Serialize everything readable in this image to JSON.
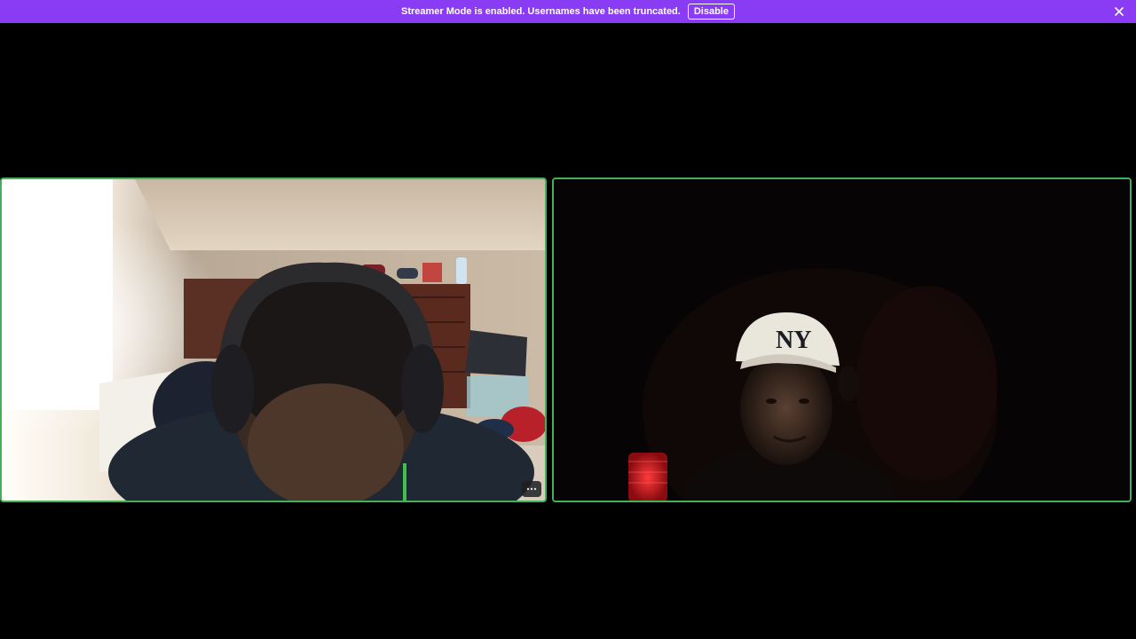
{
  "notice_bar": {
    "message": "Streamer Mode is enabled. Usernames have been truncated.",
    "disable_label": "Disable",
    "close_icon": "close-icon",
    "background": "#8a3cf5"
  },
  "call": {
    "active_speaker_border": "#43b05c",
    "tiles": [
      {
        "id": "participant-left",
        "more_icon": "ellipsis-icon"
      },
      {
        "id": "participant-right"
      }
    ]
  }
}
